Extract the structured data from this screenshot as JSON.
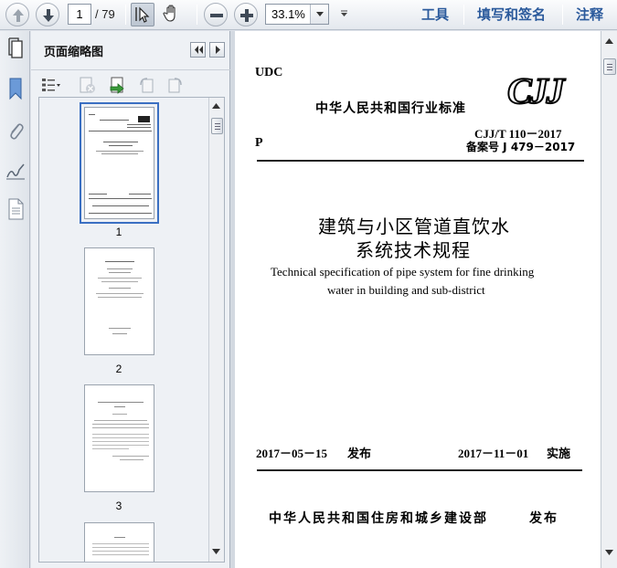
{
  "toolbar": {
    "current_page": "1",
    "page_total": "/ 79",
    "zoom": "33.1%",
    "tools_label": "工具",
    "fill_sign_label": "填写和签名",
    "comment_label": "注释"
  },
  "panel": {
    "title": "页面缩略图",
    "thumbnails": [
      {
        "number": "1"
      },
      {
        "number": "2"
      },
      {
        "number": "3"
      }
    ]
  },
  "document": {
    "udc": "UDC",
    "standard_heading": "中华人民共和国行业标准",
    "logo_text": "CJJ",
    "code": "CJJ/T 110－2017",
    "record_no": "备案号 J 479－2017",
    "category": "P",
    "title_cn_line1": "建筑与小区管道直饮水",
    "title_cn_line2": "系统技术规程",
    "title_en_line1": "Technical specification of pipe system for fine drinking",
    "title_en_line2": "water in building and sub-district",
    "publish_date": "2017－05－15",
    "publish_label": "发布",
    "implement_date": "2017－11－01",
    "implement_label": "实施",
    "issuer": "中华人民共和国住房和城乡建设部",
    "issuer_action": "发布"
  },
  "colors": {
    "toolbar_link": "#2b5a9c",
    "selection": "#3a6fc2"
  }
}
